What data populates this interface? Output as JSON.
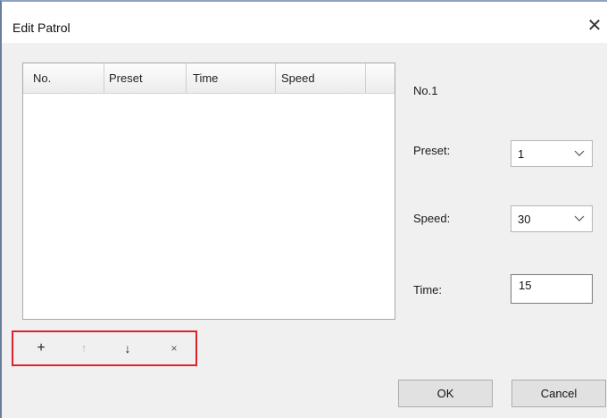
{
  "window": {
    "title": "Edit Patrol",
    "close_glyph": "✕"
  },
  "list": {
    "columns": [
      "No.",
      "Preset",
      "Time",
      "Speed"
    ],
    "rows": []
  },
  "toolbar": {
    "add_glyph": "+",
    "up_glyph": "↑",
    "down_glyph": "↓",
    "delete_glyph": "×",
    "up_disabled": true,
    "highlight_color": "#e0222a"
  },
  "form": {
    "number_label": "No.1",
    "preset_label": "Preset:",
    "preset_value": "1",
    "speed_label": "Speed:",
    "speed_value": "30",
    "time_label": "Time:",
    "time_value": "15"
  },
  "buttons": {
    "ok": "OK",
    "cancel": "Cancel"
  }
}
